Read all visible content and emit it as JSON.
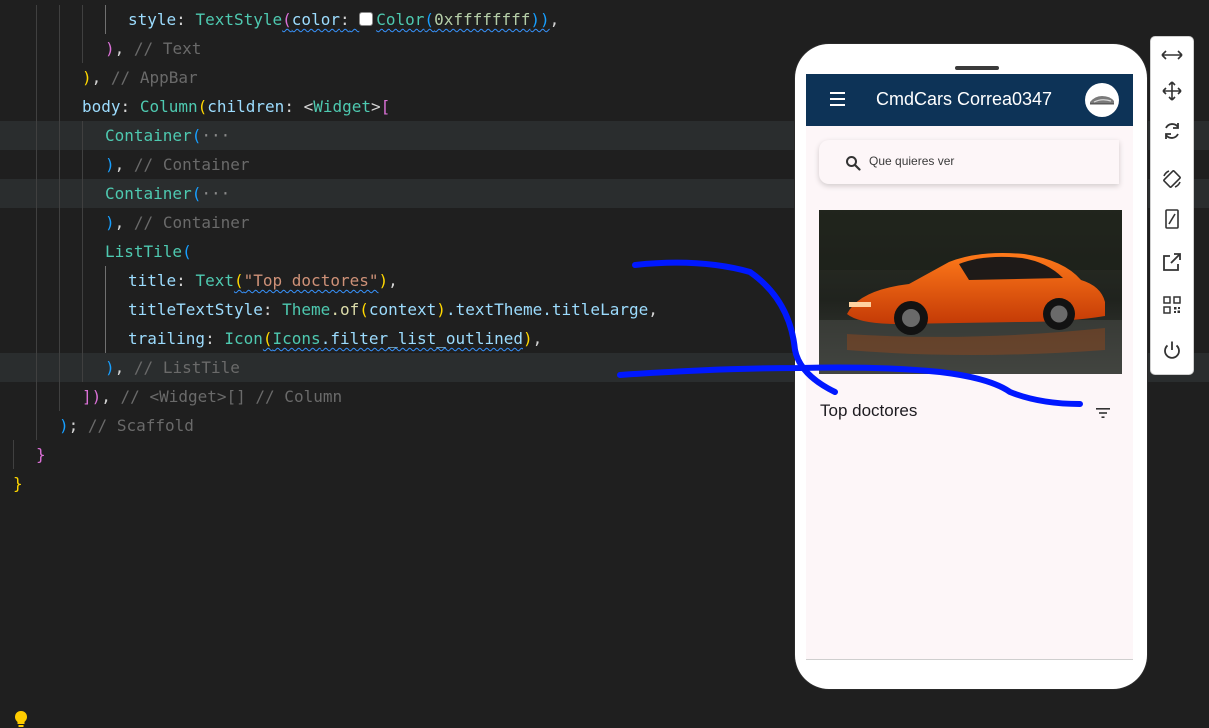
{
  "editor": {
    "line1": {
      "ident": "style",
      "colon": ":",
      "ctor": "TextStyle",
      "open": "(",
      "arg": "color",
      "colon2": ":",
      "color_ctor": "Color",
      "color_open": "(",
      "color_value": "0xffffffff",
      "close": "))",
      "comma": ","
    },
    "line2": {
      "close": ")",
      "comma": ",",
      "comment": "// Text"
    },
    "line3": {
      "close": ")",
      "comma": ",",
      "comment": "// AppBar"
    },
    "line4": {
      "ident": "body",
      "colon": ":",
      "ctor": "Column",
      "open": "(",
      "arg": "children",
      "colon2": ":",
      "type_open": "<",
      "type": "Widget",
      "type_close": ">",
      "bracket": "["
    },
    "line5": {
      "ctor": "Container",
      "open": "(",
      "fold": "···"
    },
    "line6": {
      "close": ")",
      "comma": ",",
      "comment": "// Container"
    },
    "line7": {
      "ctor": "Container",
      "open": "(",
      "fold": "···"
    },
    "line8": {
      "close": ")",
      "comma": ",",
      "comment": "// Container"
    },
    "line9": {
      "ctor": "ListTile",
      "open": "("
    },
    "line10": {
      "ident": "title",
      "colon": ":",
      "ctor": "Text",
      "open": "(",
      "string": "\"Top doctores\"",
      "close": ")",
      "comma": ","
    },
    "line11": {
      "ident": "titleTextStyle",
      "colon": ":",
      "cls": "Theme",
      "method": ".of",
      "open": "(",
      "arg": "context",
      "close": ")",
      "chain1": ".textTheme",
      "chain2": ".titleLarge",
      "comma": ","
    },
    "line12": {
      "ident": "trailing",
      "colon": ":",
      "ctor": "Icon",
      "open": "(",
      "cls": "Icons",
      "member": ".filter_list_outlined",
      "close": ")",
      "comma": ","
    },
    "line13": {
      "close": ")",
      "comma": ",",
      "comment": "// ListTile"
    },
    "line14": {
      "close": "])",
      "comma": ",",
      "comment": "// <Widget>[] // Column"
    },
    "line15": {
      "close": ")",
      "semi": ";",
      "comment": "// Scaffold"
    },
    "line16": {
      "close": "}"
    },
    "line17": {
      "close": "}"
    }
  },
  "emulator": {
    "app_title": "CmdCars Correa0347",
    "search_placeholder": "Que quieres ver",
    "tile_title": "Top doctores",
    "appbar_color": "#0d3357",
    "background_color": "#fdf6f8",
    "menu_icon": "menu-icon",
    "search_icon": "search-icon",
    "trailing_icon": "filter-list-icon",
    "avatar": "car-logo-avatar",
    "image": "orange-sports-car-photo"
  },
  "toolbar": {
    "buttons": [
      "resize-icon",
      "move-icon",
      "rotate-icon",
      "auto-rotate-icon",
      "device-frame-icon",
      "open-external-icon",
      "qr-code-icon",
      "power-icon"
    ]
  },
  "annotation": {
    "color": "#0018ff"
  }
}
